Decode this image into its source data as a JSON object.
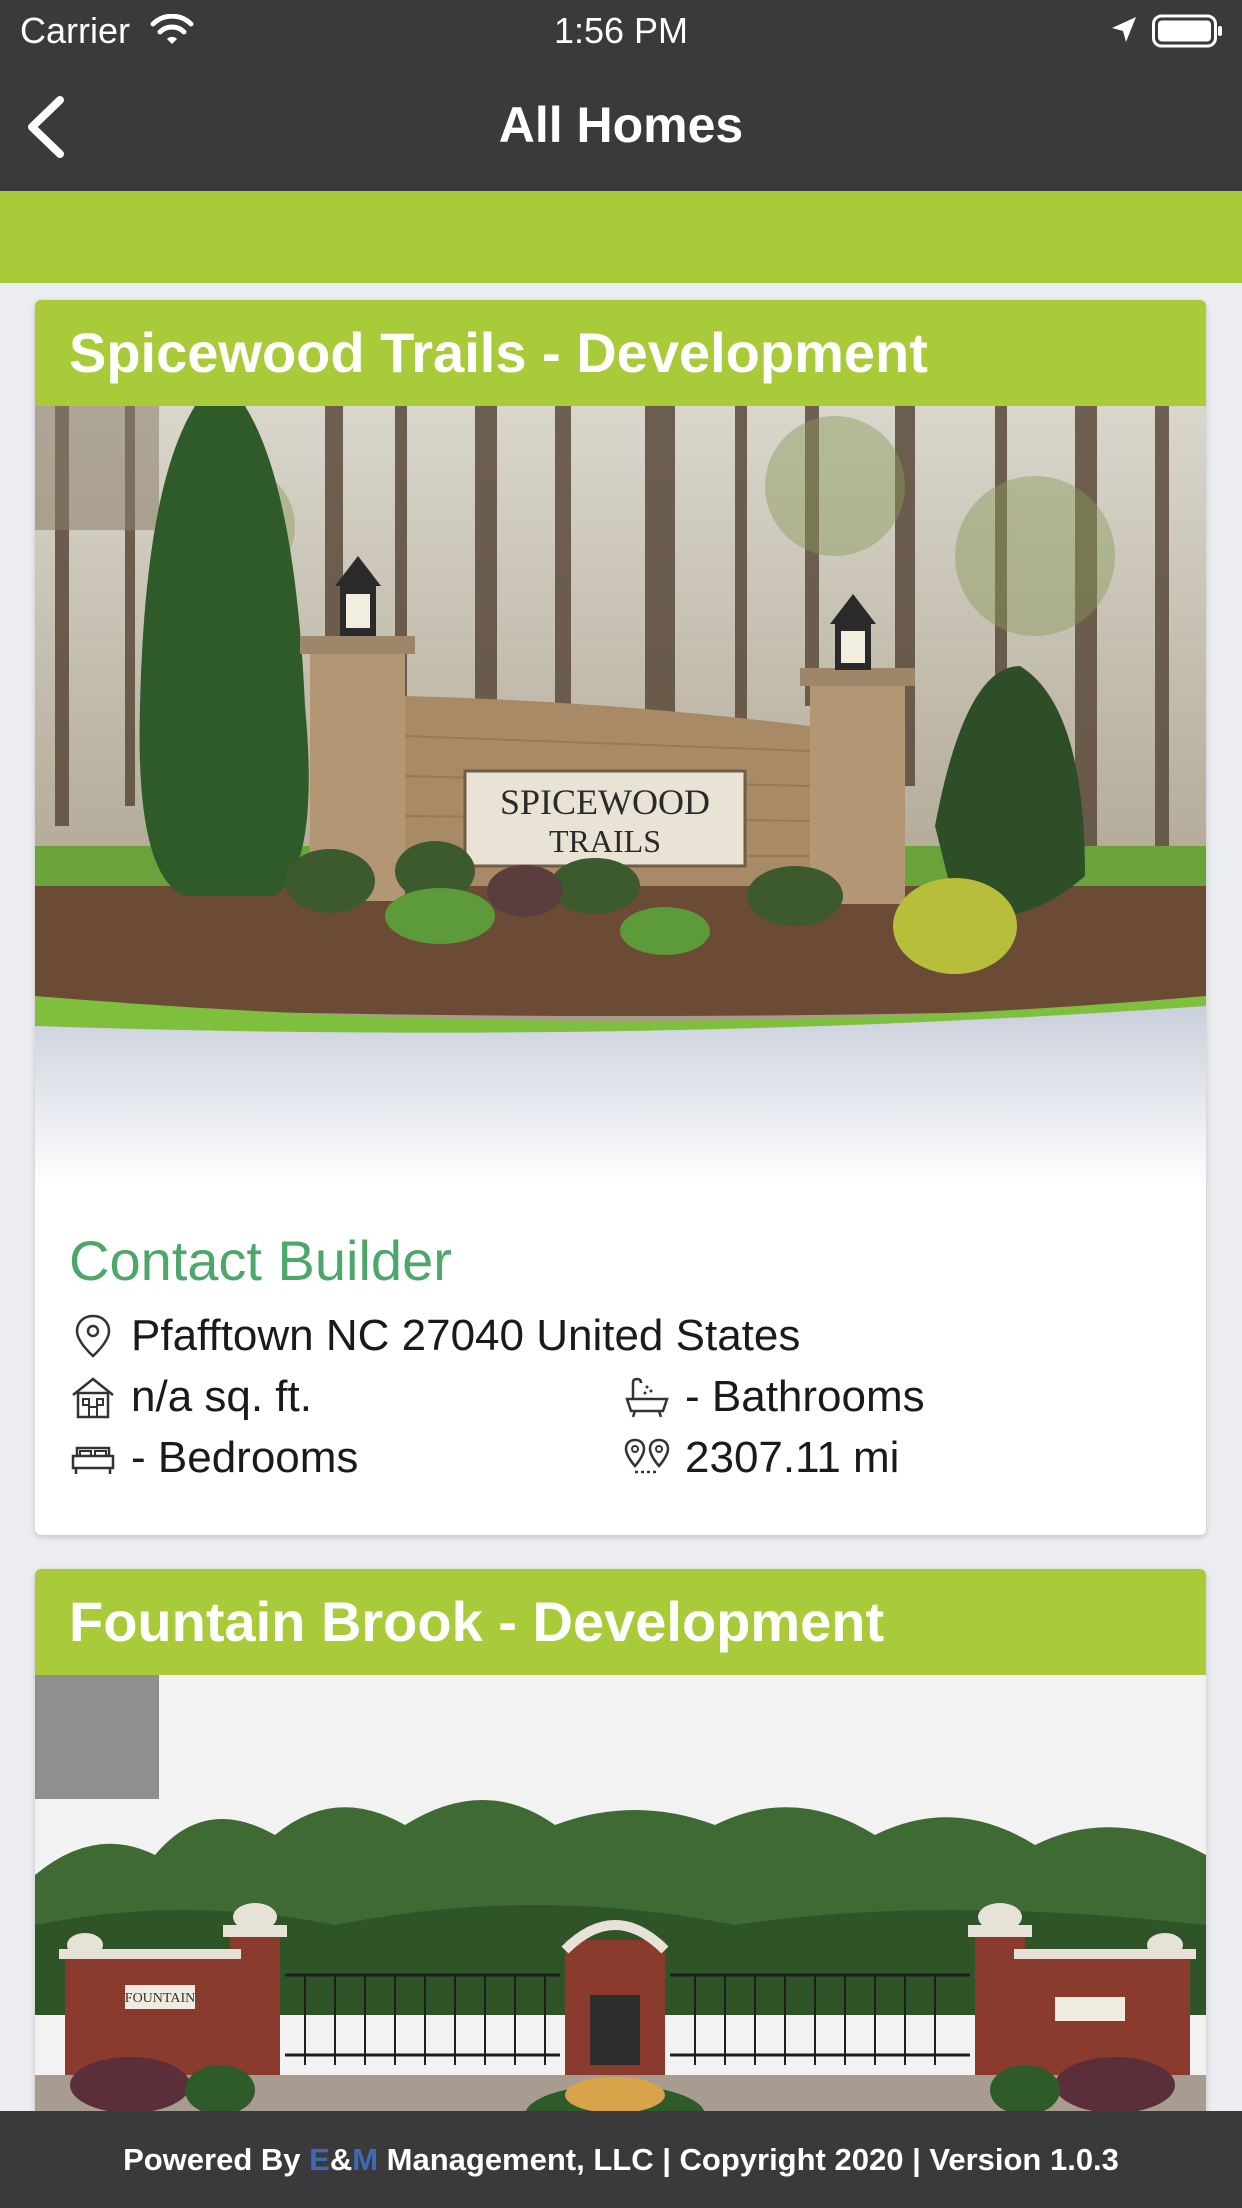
{
  "status_bar": {
    "carrier": "Carrier",
    "time": "1:56 PM"
  },
  "nav": {
    "title": "All Homes"
  },
  "listings": [
    {
      "title": "Spicewood Trails - Development",
      "sign_line1": "SPICEWOOD",
      "sign_line2": "TRAILS",
      "contact_label": "Contact Builder",
      "address": "Pfafftown  NC 27040 United States",
      "sqft": "n/a sq. ft.",
      "bathrooms": "- Bathrooms",
      "bedrooms": "- Bedrooms",
      "distance": "2307.11 mi"
    },
    {
      "title": "Fountain Brook - Development",
      "sign_text": "FOUNTAIN"
    }
  ],
  "footer": {
    "prefix": "Powered By ",
    "e": "E",
    "amp": "&",
    "m": "M",
    "suffix": " Management, LLC | Copyright 2020 | Version 1.0.3"
  },
  "colors": {
    "accent_green": "#a9cb3a",
    "bar_dark": "#3a3a3c",
    "contact_green": "#4ea76a",
    "brand_blue": "#3f6ab3"
  }
}
